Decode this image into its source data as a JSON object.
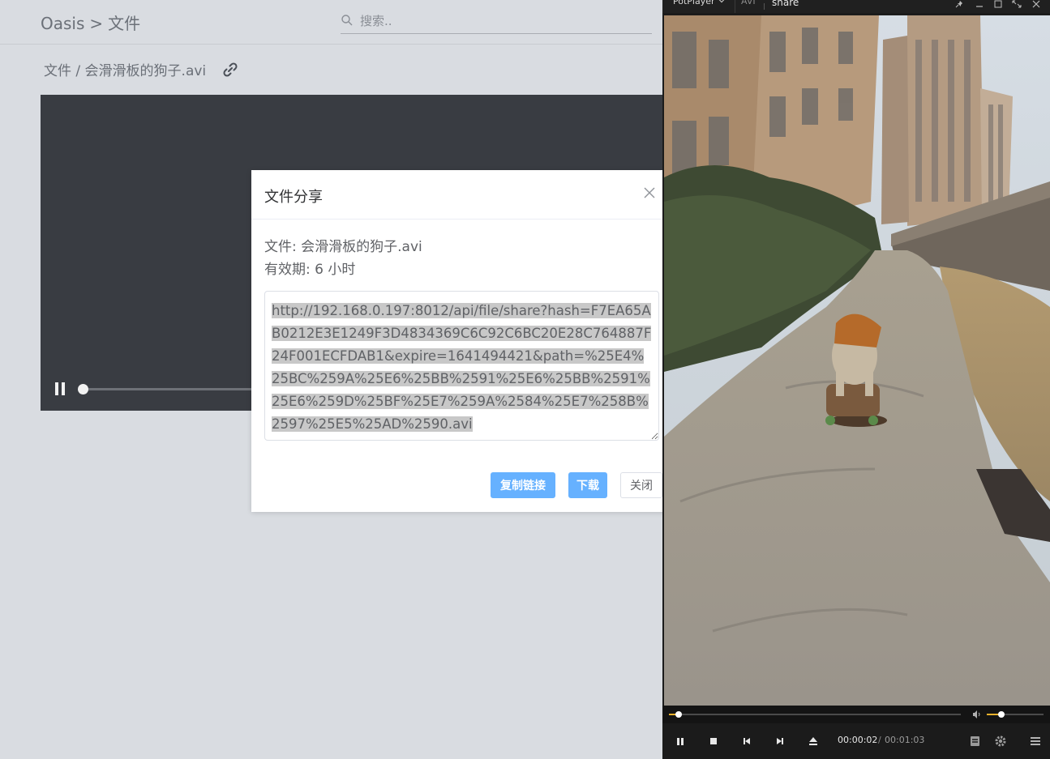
{
  "app": {
    "breadcrumb": {
      "root": "Oasis",
      "separator": ">",
      "current": "文件"
    },
    "search": {
      "placeholder": "搜索.."
    },
    "file_path": "文件 / 会滑滑板的狗子.avi",
    "video": {
      "progress": 0.0
    }
  },
  "dialog": {
    "title": "文件分享",
    "file_line": "文件: 会滑滑板的狗子.avi",
    "expire_line": "有效期: 6 小时",
    "share_url": "http://192.168.0.197:8012/api/file/share?hash=F7EA65AB0212E3E1249F3D4834369C6C92C6BC20E28C764887F24F001ECFDAB1&expire=1641494421&path=%25E4%25BC%259A%25E6%25BB%2591%25E6%25BB%2591%25E6%259D%25BF%25E7%259A%2584%25E7%258B%2597%25E5%25AD%2590.avi",
    "buttons": {
      "copy": "复制链接",
      "download": "下载",
      "close": "关闭"
    },
    "accent_color": "#66b1ff"
  },
  "player": {
    "brand": "PotPlayer",
    "format": "AVI",
    "filename": "share",
    "time_current": "00:00:02",
    "time_separator": "/",
    "time_total": "00:01:03",
    "seek_progress": 0.032,
    "volume": 0.25,
    "accent_color": "#e8b12c",
    "icons": [
      "pin-icon",
      "minimize-icon",
      "maximize-icon",
      "fullscreen-icon",
      "close-icon",
      "pause-icon",
      "stop-icon",
      "previous-icon",
      "next-icon",
      "eject-icon",
      "playlist-icon",
      "settings-icon",
      "menu-icon",
      "volume-icon"
    ]
  }
}
